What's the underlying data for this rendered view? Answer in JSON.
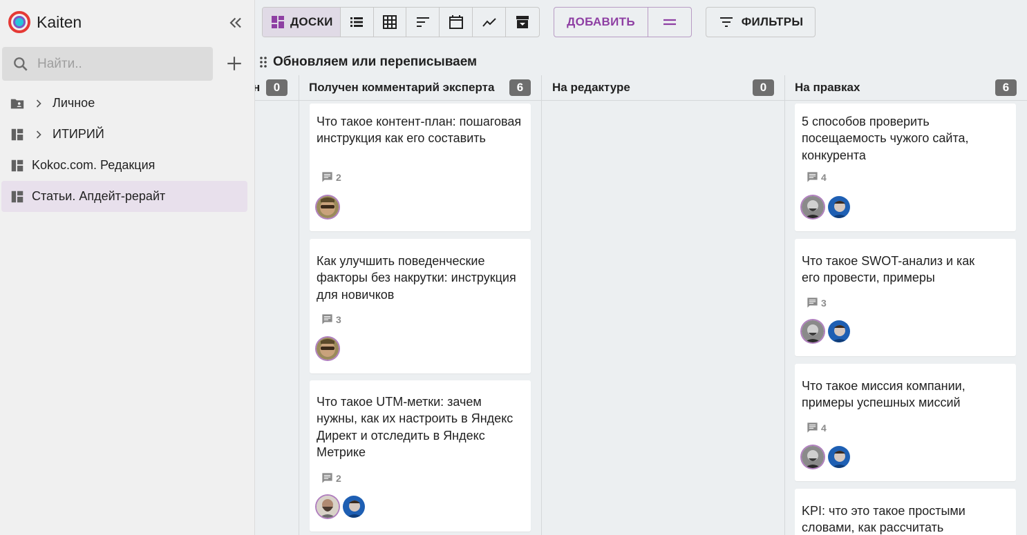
{
  "app": {
    "name": "Kaiten"
  },
  "sidebar": {
    "search_placeholder": "Найти..",
    "items": [
      {
        "label": "Личное",
        "icon": "folder-person-icon",
        "expandable": true,
        "active": false
      },
      {
        "label": "ИТИРИЙ",
        "icon": "dashboard-icon",
        "expandable": true,
        "active": false
      },
      {
        "label": "Kokoc.com. Редакция",
        "icon": "dashboard-icon",
        "expandable": false,
        "active": false
      },
      {
        "label": "Статьи. Апдейт-рерайт",
        "icon": "dashboard-icon",
        "expandable": false,
        "active": true
      }
    ]
  },
  "toolbar": {
    "boards_label": "ДОСКИ",
    "add_label": "ДОБАВИТЬ",
    "filters_label": "ФИЛЬТРЫ"
  },
  "lane": {
    "title": "Обновляем или переписываем"
  },
  "columns": [
    {
      "title": "н",
      "count": "0"
    },
    {
      "title": "Получен комментарий эксперта",
      "count": "6"
    },
    {
      "title": "На редактуре",
      "count": "0"
    },
    {
      "title": "На правках",
      "count": "6"
    }
  ],
  "cards": {
    "expert": [
      {
        "title": "Что такое контент-план: пошаговая инструкция как его составить",
        "comments": "2",
        "avatars": [
          "avatar-sunglasses"
        ]
      },
      {
        "title": "Как улучшить поведенческие факторы без накрутки: инструкция для новичков",
        "comments": "3",
        "avatars": [
          "avatar-sunglasses"
        ]
      },
      {
        "title": "Что такое UTM-метки: зачем нужны, как их настроить в Яндекс Директ и отследить в Яндекс Метрике",
        "comments": "2",
        "avatars": [
          "avatar-bearded",
          "avatar-blue"
        ]
      }
    ],
    "fixes": [
      {
        "title": "5 способов проверить посещаемость чужого сайта, конкурента",
        "comments": "4",
        "avatars": [
          "avatar-bw",
          "avatar-blue"
        ]
      },
      {
        "title": "Что такое SWOT-анализ и как его провести, примеры",
        "comments": "3",
        "avatars": [
          "avatar-bw",
          "avatar-blue"
        ]
      },
      {
        "title": "Что такое миссия компании, примеры успешных миссий",
        "comments": "4",
        "avatars": [
          "avatar-bw",
          "avatar-blue"
        ]
      },
      {
        "title": "KPI: что это такое простыми словами, как рассчитать",
        "comments": "",
        "avatars": []
      }
    ]
  },
  "colors": {
    "accent": "#8e3fa3",
    "active_bg": "#e8e0ec",
    "count_badge": "#6e6e6e"
  }
}
